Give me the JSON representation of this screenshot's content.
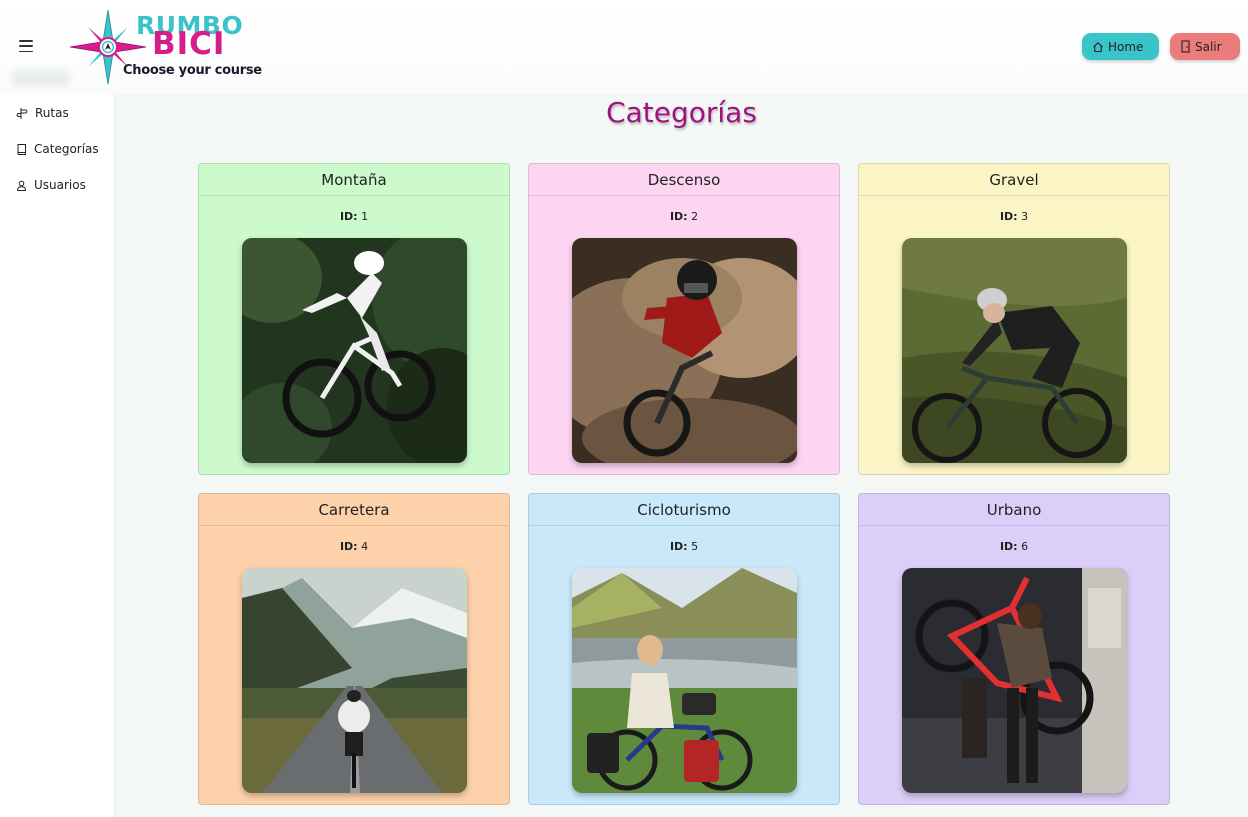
{
  "header": {
    "logo": {
      "line1": "RUMBO",
      "line2": "BICI",
      "slogan": "Choose your course"
    },
    "buttons": {
      "home_label": "Home",
      "salir_label": "Salir"
    }
  },
  "sidebar": {
    "items": [
      {
        "label": "Rutas",
        "icon": "signpost-icon"
      },
      {
        "label": "Categorías",
        "icon": "book-icon"
      },
      {
        "label": "Usuarios",
        "icon": "user-icon"
      }
    ]
  },
  "main": {
    "title": "Categorías",
    "id_label": "ID:",
    "cards": [
      {
        "name": "Montaña",
        "id": "1",
        "color": "#ccfacc",
        "image": "mountain-bike rider jumping in forest"
      },
      {
        "name": "Descenso",
        "id": "2",
        "color": "#fdd5f2",
        "image": "downhill rider in dust cloud"
      },
      {
        "name": "Gravel",
        "id": "3",
        "color": "#fbf5c6",
        "image": "gravel cyclist on grassy hill"
      },
      {
        "name": "Carretera",
        "id": "4",
        "color": "#fdd1a9",
        "image": "road cyclist on mountain road"
      },
      {
        "name": "Cicloturismo",
        "id": "5",
        "color": "#c9e9fb",
        "image": "touring cyclist with loaded bike"
      },
      {
        "name": "Urbano",
        "id": "6",
        "color": "#dbcef8",
        "image": "person carrying red bike in city"
      }
    ]
  },
  "colors": {
    "title": "#a0127e",
    "home_button": "#38c4c8",
    "salir_button": "#ec7b7b",
    "brand_teal": "#3bc3c9",
    "brand_magenta": "#d61d8b"
  }
}
